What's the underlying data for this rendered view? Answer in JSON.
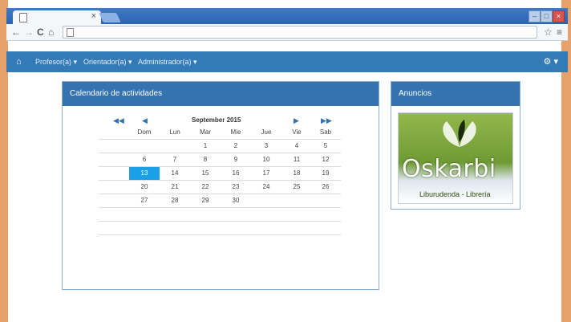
{
  "browser": {
    "tab": {
      "title": "",
      "close_glyph": "×"
    },
    "window_controls": [
      "–",
      "□",
      "×"
    ],
    "nav": {
      "back": "←",
      "forward": "→",
      "reload": "C",
      "home": "⌂"
    },
    "address": {
      "value": ""
    },
    "right_controls": {
      "star": "☆",
      "menu": "≡"
    }
  },
  "navbar": {
    "home_icon": "home-icon",
    "menus": [
      {
        "label": "Profesor(a) ▾"
      },
      {
        "label": "Orientador(a) ▾"
      },
      {
        "label": "Administrador(a) ▾"
      }
    ],
    "settings_label": "⚙ ▾"
  },
  "calendar_panel": {
    "title": "Calendario de actividades",
    "month_label": "September 2015",
    "prev_year": "◀◀",
    "prev_month": "◀",
    "next_month": "▶",
    "next_year": "▶▶",
    "weekdays": [
      "Dom",
      "Lun",
      "Mar",
      "Mie",
      "Jue",
      "Vie",
      "Sab"
    ],
    "weeks": [
      [
        "",
        "",
        "1",
        "2",
        "3",
        "4",
        "5"
      ],
      [
        "6",
        "7",
        "8",
        "9",
        "10",
        "11",
        "12"
      ],
      [
        "13",
        "14",
        "15",
        "16",
        "17",
        "18",
        "19"
      ],
      [
        "20",
        "21",
        "22",
        "23",
        "24",
        "25",
        "26"
      ],
      [
        "27",
        "28",
        "29",
        "30",
        "",
        "",
        ""
      ]
    ],
    "today": "13"
  },
  "ads_panel": {
    "title": "Anuncios",
    "logo_brand": "Oskarbi",
    "logo_subtitle": "Liburudenda - Librería"
  },
  "colors": {
    "navbar": "#337ab7",
    "panel_header": "#3572b0",
    "today": "#1aa0e6"
  }
}
